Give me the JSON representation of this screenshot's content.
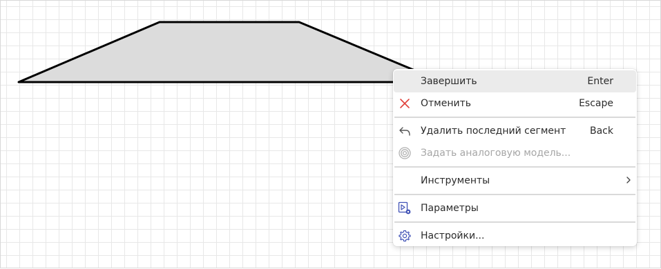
{
  "canvas": {
    "shape": {
      "fill": "#dcdcdc",
      "stroke": "#000000",
      "kind": "trapezoid"
    }
  },
  "context_menu": {
    "items": [
      {
        "label": "Завершить",
        "shortcut": "Enter",
        "icon": "none",
        "state": "hover"
      },
      {
        "label": "Отменить",
        "shortcut": "Escape",
        "icon": "close-icon",
        "icon_color": "#e0403a"
      },
      {
        "label": "Удалить последний сегмент",
        "shortcut": "Back",
        "icon": "undo-arrow-icon"
      },
      {
        "label": "Задать аналоговую модель...",
        "shortcut": "",
        "icon": "spiral-icon",
        "state": "disabled"
      },
      {
        "label": "Инструменты",
        "shortcut": "",
        "icon": "none",
        "submenu": true
      },
      {
        "label": "Параметры",
        "shortcut": "",
        "icon": "parameters-icon",
        "icon_color": "#3f51b5"
      },
      {
        "label": "Настройки...",
        "shortcut": "",
        "icon": "gear-icon",
        "icon_color": "#3f51b5"
      }
    ]
  }
}
